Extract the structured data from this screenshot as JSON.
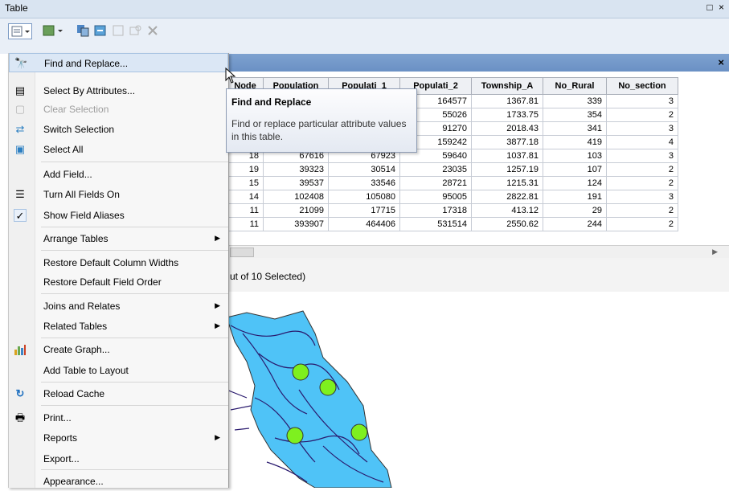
{
  "window": {
    "title": "Table",
    "controls": "□ ×"
  },
  "tab": {
    "close": "×"
  },
  "table": {
    "columns": [
      "Node",
      "Population",
      "Populati_1",
      "Populati_2",
      "Township_A",
      "No_Rural",
      "No_section"
    ],
    "rows": [
      [
        "",
        "",
        "",
        "164577",
        "1367.81",
        "339",
        "3"
      ],
      [
        "",
        "",
        "",
        "55026",
        "1733.75",
        "354",
        "2"
      ],
      [
        "",
        "",
        "",
        "91270",
        "2018.43",
        "341",
        "3"
      ],
      [
        "",
        "",
        "",
        "159242",
        "3877.18",
        "419",
        "4"
      ],
      [
        "18",
        "67616",
        "67923",
        "59640",
        "1037.81",
        "103",
        "3"
      ],
      [
        "19",
        "39323",
        "30514",
        "23035",
        "1257.19",
        "107",
        "2"
      ],
      [
        "15",
        "39537",
        "33546",
        "28721",
        "1215.31",
        "124",
        "2"
      ],
      [
        "14",
        "102408",
        "105080",
        "95005",
        "2822.81",
        "191",
        "3"
      ],
      [
        "11",
        "21099",
        "17715",
        "17318",
        "413.12",
        "29",
        "2"
      ],
      [
        "11",
        "393907",
        "464406",
        "531514",
        "2550.62",
        "244",
        "2"
      ]
    ],
    "selection_status": "ut of 10 Selected)"
  },
  "menu": {
    "items": [
      {
        "label": "Find and Replace...",
        "icon": "binoculars-icon",
        "glyph": "🔭",
        "highlighted": true
      },
      {
        "label": "Select By Attributes...",
        "icon": "select-attributes-icon",
        "glyph": "▤"
      },
      {
        "label": "Clear Selection",
        "icon": "clear-selection-icon",
        "glyph": "▢",
        "disabled": true
      },
      {
        "label": "Switch Selection",
        "icon": "switch-selection-icon",
        "glyph": "⇄"
      },
      {
        "label": "Select All",
        "icon": "select-all-icon",
        "glyph": "▣"
      },
      {
        "label": "Add Field...",
        "icon": "",
        "glyph": ""
      },
      {
        "label": "Turn All Fields On",
        "icon": "fields-icon",
        "glyph": "☰"
      },
      {
        "label": "Show Field Aliases",
        "icon": "checkmark-icon",
        "glyph": "✓"
      },
      {
        "label": "Arrange Tables",
        "submenu": true
      },
      {
        "label": "Restore Default Column Widths"
      },
      {
        "label": "Restore Default Field Order"
      },
      {
        "label": "Joins and Relates",
        "submenu": true
      },
      {
        "label": "Related Tables",
        "submenu": true
      },
      {
        "label": "Create Graph...",
        "icon": "bar-chart-icon",
        "glyph": "📊"
      },
      {
        "label": "Add Table to Layout"
      },
      {
        "label": "Reload Cache",
        "icon": "reload-icon",
        "glyph": "↻"
      },
      {
        "label": "Print...",
        "icon": "printer-icon",
        "glyph": "🖶"
      },
      {
        "label": "Reports",
        "submenu": true
      },
      {
        "label": "Export..."
      },
      {
        "label": "Appearance..."
      }
    ]
  },
  "tooltip": {
    "title": "Find and Replace",
    "description": "Find or replace particular attribute values in this table."
  },
  "map": {
    "polygon_color": "#4fc3f7",
    "river_color": "#2a1a6e",
    "point_color": "#7ef01f"
  }
}
